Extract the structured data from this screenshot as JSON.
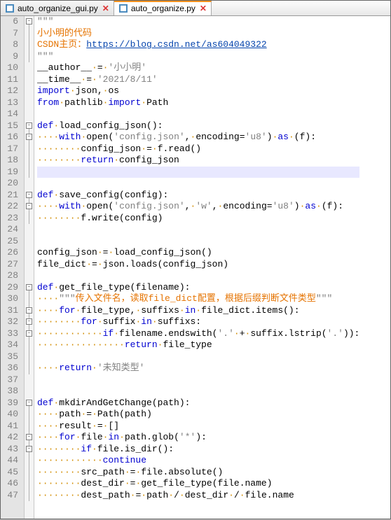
{
  "tabs": {
    "items": [
      {
        "label": "auto_organize_gui.py",
        "active": false
      },
      {
        "label": "auto_organize.py",
        "active": true
      }
    ],
    "close_glyph": "✕"
  },
  "gutter": {
    "start": 6,
    "end": 47
  },
  "fold_boxes": [
    6,
    15,
    16,
    21,
    22,
    29,
    31,
    32,
    33,
    39,
    42,
    43
  ],
  "code": {
    "l6": {
      "pre": "",
      "html": "<span class='s'>\"\"\"</span>"
    },
    "l7": {
      "pre": "",
      "html": "<span class='cm'>小小明的代码</span>"
    },
    "l8": {
      "pre": "",
      "html": "<span class='cm'>CSDN</span><span class='cm'>主页：</span><span class='lnk'>https://blog.csdn.net/as604049322</span>"
    },
    "l9": {
      "pre": "",
      "html": "<span class='s'>\"\"\"</span>"
    },
    "l10": {
      "pre": "",
      "html": "__author__<span class='ws'>·</span>=<span class='ws'>·</span><span class='st'>'小小明'</span>"
    },
    "l11": {
      "pre": "",
      "html": "__time__<span class='ws'>·</span>=<span class='ws'>·</span><span class='st'>'2021/8/11'</span>"
    },
    "l12": {
      "pre": "",
      "html": "<span class='k'>import</span><span class='ws'>·</span>json,<span class='ws'>·</span>os"
    },
    "l13": {
      "pre": "",
      "html": "<span class='k'>from</span><span class='ws'>·</span>pathlib<span class='ws'>·</span><span class='k'>import</span><span class='ws'>·</span>Path"
    },
    "l14": {
      "pre": "",
      "html": ""
    },
    "l15": {
      "pre": "",
      "html": "<span class='k'>def</span><span class='ws'>·</span><span class='fn'>load_config_json</span>():"
    },
    "l16": {
      "pre": "",
      "html": "<span class='ws'>····</span><span class='k'>with</span><span class='ws'>·</span>open(<span class='st'>'config.json'</span>,<span class='ws'>·</span>encoding=<span class='st'>'u8'</span>)<span class='ws'>·</span><span class='k'>as</span><span class='ws'>·</span>(f):"
    },
    "l17": {
      "pre": "",
      "html": "<span class='ws'>········</span>config_json<span class='ws'>·</span>=<span class='ws'>·</span>f.read()"
    },
    "l18": {
      "pre": "",
      "html": "<span class='ws'>········</span><span class='k'>return</span><span class='ws'>·</span>config_json"
    },
    "l19": {
      "pre": "",
      "html": "",
      "hl": true
    },
    "l20": {
      "pre": "",
      "html": ""
    },
    "l21": {
      "pre": "",
      "html": "<span class='k'>def</span><span class='ws'>·</span><span class='fn'>save_config</span>(config):"
    },
    "l22": {
      "pre": "",
      "html": "<span class='ws'>····</span><span class='k'>with</span><span class='ws'>·</span>open(<span class='st'>'config.json'</span>,<span class='ws'>·</span><span class='st'>'w'</span>,<span class='ws'>·</span>encoding=<span class='st'>'u8'</span>)<span class='ws'>·</span><span class='k'>as</span><span class='ws'>·</span>(f):"
    },
    "l23": {
      "pre": "",
      "html": "<span class='ws'>········</span>f.write(config)"
    },
    "l24": {
      "pre": "",
      "html": ""
    },
    "l25": {
      "pre": "",
      "html": ""
    },
    "l26": {
      "pre": "",
      "html": "config_json<span class='ws'>·</span>=<span class='ws'>·</span>load_config_json()"
    },
    "l27": {
      "pre": "",
      "html": "file_dict<span class='ws'>·</span>=<span class='ws'>·</span>json.loads(config_json)"
    },
    "l28": {
      "pre": "",
      "html": ""
    },
    "l29": {
      "pre": "",
      "html": "<span class='k'>def</span><span class='ws'>·</span><span class='fn'>get_file_type</span>(filename):"
    },
    "l30": {
      "pre": "",
      "html": "<span class='ws'>····</span><span class='s'>\"\"\"</span><span class='cm'>传入文件名，读取file_dict配置，根据后缀判断文件类型</span><span class='s'>\"\"\"</span>"
    },
    "l31": {
      "pre": "",
      "html": "<span class='ws'>····</span><span class='k'>for</span><span class='ws'>·</span>file_type,<span class='ws'>·</span>suffixs<span class='ws'>·</span><span class='k'>in</span><span class='ws'>·</span>file_dict.items():"
    },
    "l32": {
      "pre": "",
      "html": "<span class='ws'>········</span><span class='k'>for</span><span class='ws'>·</span>suffix<span class='ws'>·</span><span class='k'>in</span><span class='ws'>·</span>suffixs:"
    },
    "l33": {
      "pre": "",
      "html": "<span class='ws'>············</span><span class='k'>if</span><span class='ws'>·</span>filename.endswith(<span class='st'>'.'</span><span class='ws'>·</span>+<span class='ws'>·</span>suffix.lstrip(<span class='st'>'.'</span>)):"
    },
    "l34": {
      "pre": "",
      "html": "<span class='ws'>················</span><span class='k'>return</span><span class='ws'>·</span>file_type"
    },
    "l35": {
      "pre": "",
      "html": ""
    },
    "l36": {
      "pre": "",
      "html": "<span class='ws'>····</span><span class='k'>return</span><span class='ws'>·</span><span class='st'>'未知类型'</span>"
    },
    "l37": {
      "pre": "",
      "html": ""
    },
    "l38": {
      "pre": "",
      "html": ""
    },
    "l39": {
      "pre": "",
      "html": "<span class='k'>def</span><span class='ws'>·</span><span class='fn'>mkdirAndGetChange</span>(path):"
    },
    "l40": {
      "pre": "",
      "html": "<span class='ws'>····</span>path<span class='ws'>·</span>=<span class='ws'>·</span>Path(path)"
    },
    "l41": {
      "pre": "",
      "html": "<span class='ws'>····</span>result<span class='ws'>·</span>=<span class='ws'>·</span>[]"
    },
    "l42": {
      "pre": "",
      "html": "<span class='ws'>····</span><span class='k'>for</span><span class='ws'>·</span>file<span class='ws'>·</span><span class='k'>in</span><span class='ws'>·</span>path.glob(<span class='st'>'*'</span>):"
    },
    "l43": {
      "pre": "",
      "html": "<span class='ws'>········</span><span class='k'>if</span><span class='ws'>·</span>file.is_dir():"
    },
    "l44": {
      "pre": "",
      "html": "<span class='ws'>············</span><span class='k'>continue</span>"
    },
    "l45": {
      "pre": "",
      "html": "<span class='ws'>········</span>src_path<span class='ws'>·</span>=<span class='ws'>·</span>file.absolute()"
    },
    "l46": {
      "pre": "",
      "html": "<span class='ws'>········</span>dest_dir<span class='ws'>·</span>=<span class='ws'>·</span>get_file_type(file.name)"
    },
    "l47": {
      "pre": "",
      "html": "<span class='ws'>········</span>dest_path<span class='ws'>·</span>=<span class='ws'>·</span>path<span class='ws'>·</span>/<span class='ws'>·</span>dest_dir<span class='ws'>·</span>/<span class='ws'>·</span>file.name"
    }
  }
}
